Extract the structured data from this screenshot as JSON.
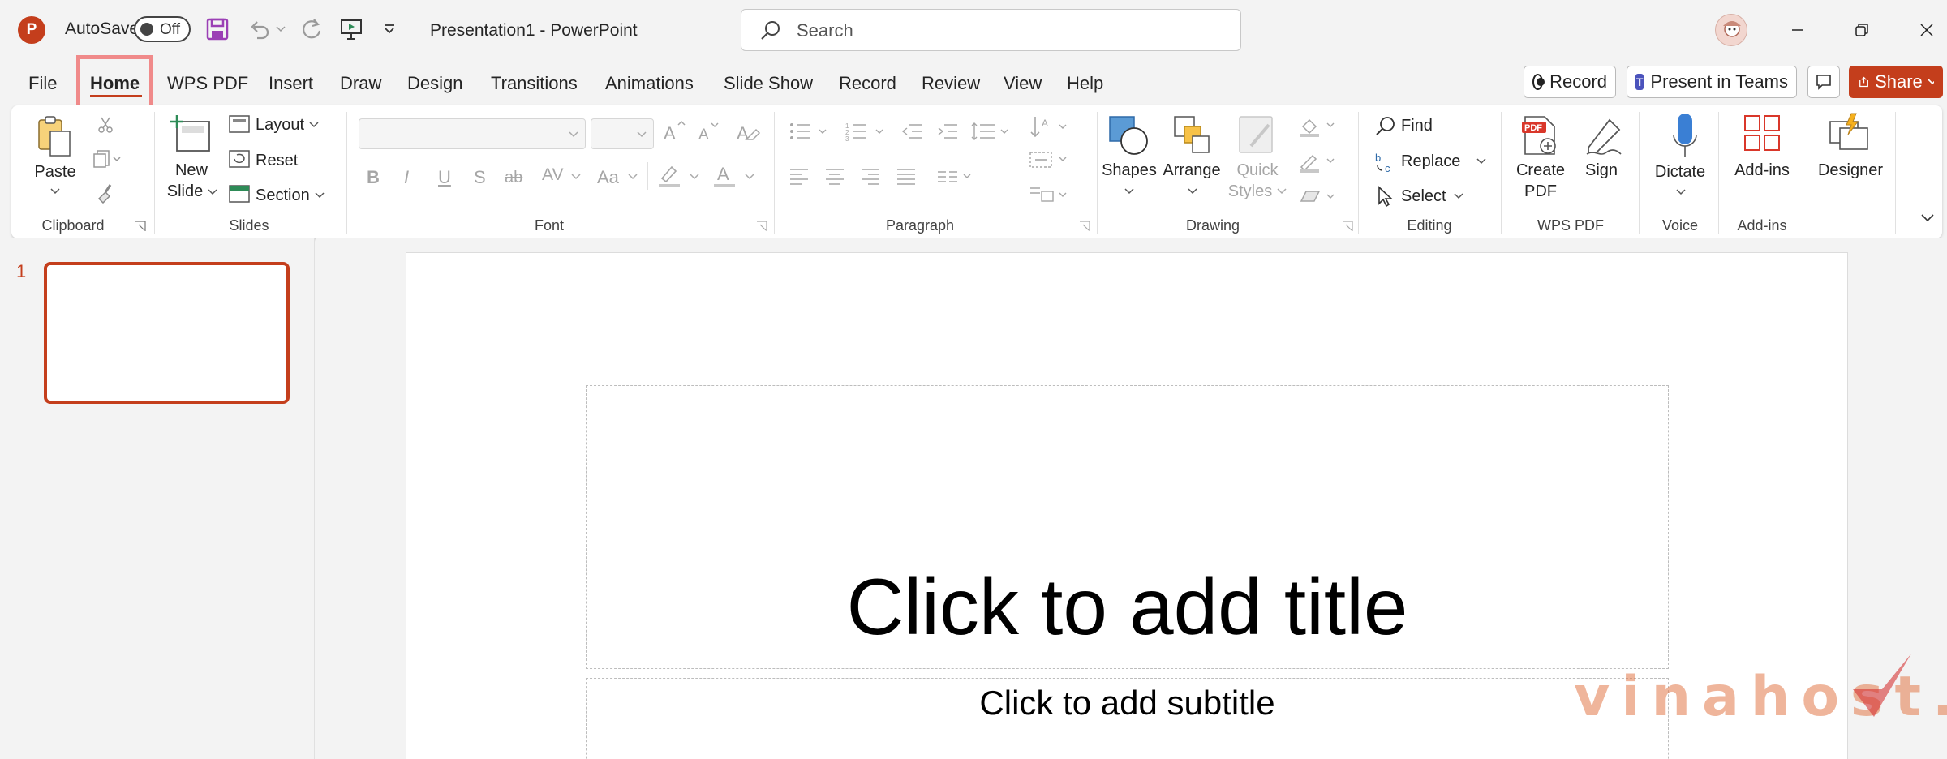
{
  "app": {
    "logo_letter": "P",
    "autosave_label": "AutoSave",
    "autosave_state": "Off",
    "document_title": "Presentation1  -  PowerPoint",
    "search_placeholder": "Search",
    "accent_color": "#c43e1c"
  },
  "menu": {
    "tabs": [
      "File",
      "Home",
      "WPS PDF",
      "Insert",
      "Draw",
      "Design",
      "Transitions",
      "Animations",
      "Slide Show",
      "Record",
      "Review",
      "View",
      "Help"
    ],
    "active_tab": "Home",
    "record_button": "Record",
    "present_teams_button": "Present in Teams",
    "share_button": "Share"
  },
  "ribbon": {
    "clipboard": {
      "paste": "Paste",
      "group": "Clipboard"
    },
    "slides": {
      "new_slide_1": "New",
      "new_slide_2": "Slide",
      "layout": "Layout",
      "reset": "Reset",
      "section": "Section",
      "group": "Slides"
    },
    "font": {
      "bold": "B",
      "italic": "I",
      "underline": "U",
      "shadow": "S",
      "strike": "ab",
      "spacing": "AV",
      "case": "Aa",
      "group": "Font"
    },
    "paragraph": {
      "group": "Paragraph"
    },
    "drawing": {
      "shapes": "Shapes",
      "arrange": "Arrange",
      "quick_styles_1": "Quick",
      "quick_styles_2": "Styles",
      "group": "Drawing"
    },
    "editing": {
      "find": "Find",
      "replace": "Replace",
      "select": "Select",
      "group": "Editing"
    },
    "wps_pdf": {
      "create_pdf_1": "Create",
      "create_pdf_2": "PDF",
      "sign": "Sign",
      "group": "WPS PDF",
      "pdf_badge": "PDF"
    },
    "voice": {
      "dictate": "Dictate",
      "group": "Voice"
    },
    "addins": {
      "addins": "Add-ins",
      "group": "Add-ins"
    },
    "designer": {
      "designer": "Designer"
    }
  },
  "slides_pane": {
    "slide_number": "1"
  },
  "slide": {
    "title_placeholder": "Click to add title",
    "subtitle_placeholder": "Click to add subtitle"
  },
  "watermark": {
    "text": "vinahost."
  }
}
